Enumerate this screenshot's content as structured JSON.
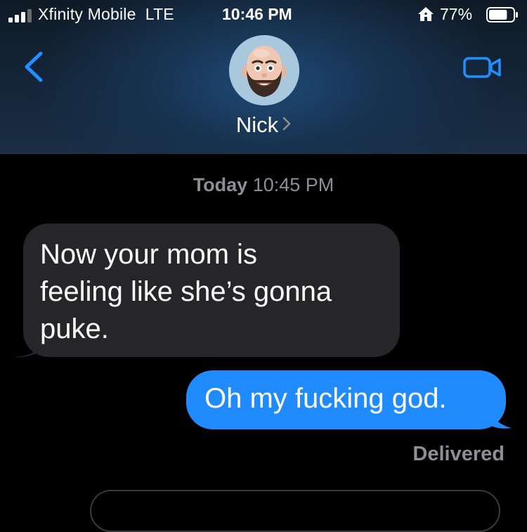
{
  "status_bar": {
    "carrier": "Xfinity Mobile",
    "network": "LTE",
    "time": "10:46 PM",
    "battery_percent": "77%",
    "battery_level": 0.77,
    "signal_bars": 4,
    "signal_bars_filled": 3,
    "icons": [
      "signal-icon",
      "home-icon",
      "battery-icon"
    ]
  },
  "conversation": {
    "contact_name": "Nick",
    "icons": [
      "back-chevron-icon",
      "memoji-avatar",
      "chevron-right-icon",
      "video-camera-icon"
    ]
  },
  "messages": {
    "timestamp_day": "Today",
    "timestamp_time": "10:45 PM",
    "received": [
      {
        "line1": "Now your mom is",
        "line2": "feeling like she’s gonna",
        "line3": "puke."
      }
    ],
    "sent": [
      {
        "text": "Oh my fucking god."
      }
    ],
    "status": "Delivered"
  },
  "colors": {
    "sent_bubble": "#1f8bff",
    "received_bubble": "#26262a",
    "accent": "#1e90ff",
    "secondary_text": "#8e8e93",
    "background": "#000000"
  }
}
